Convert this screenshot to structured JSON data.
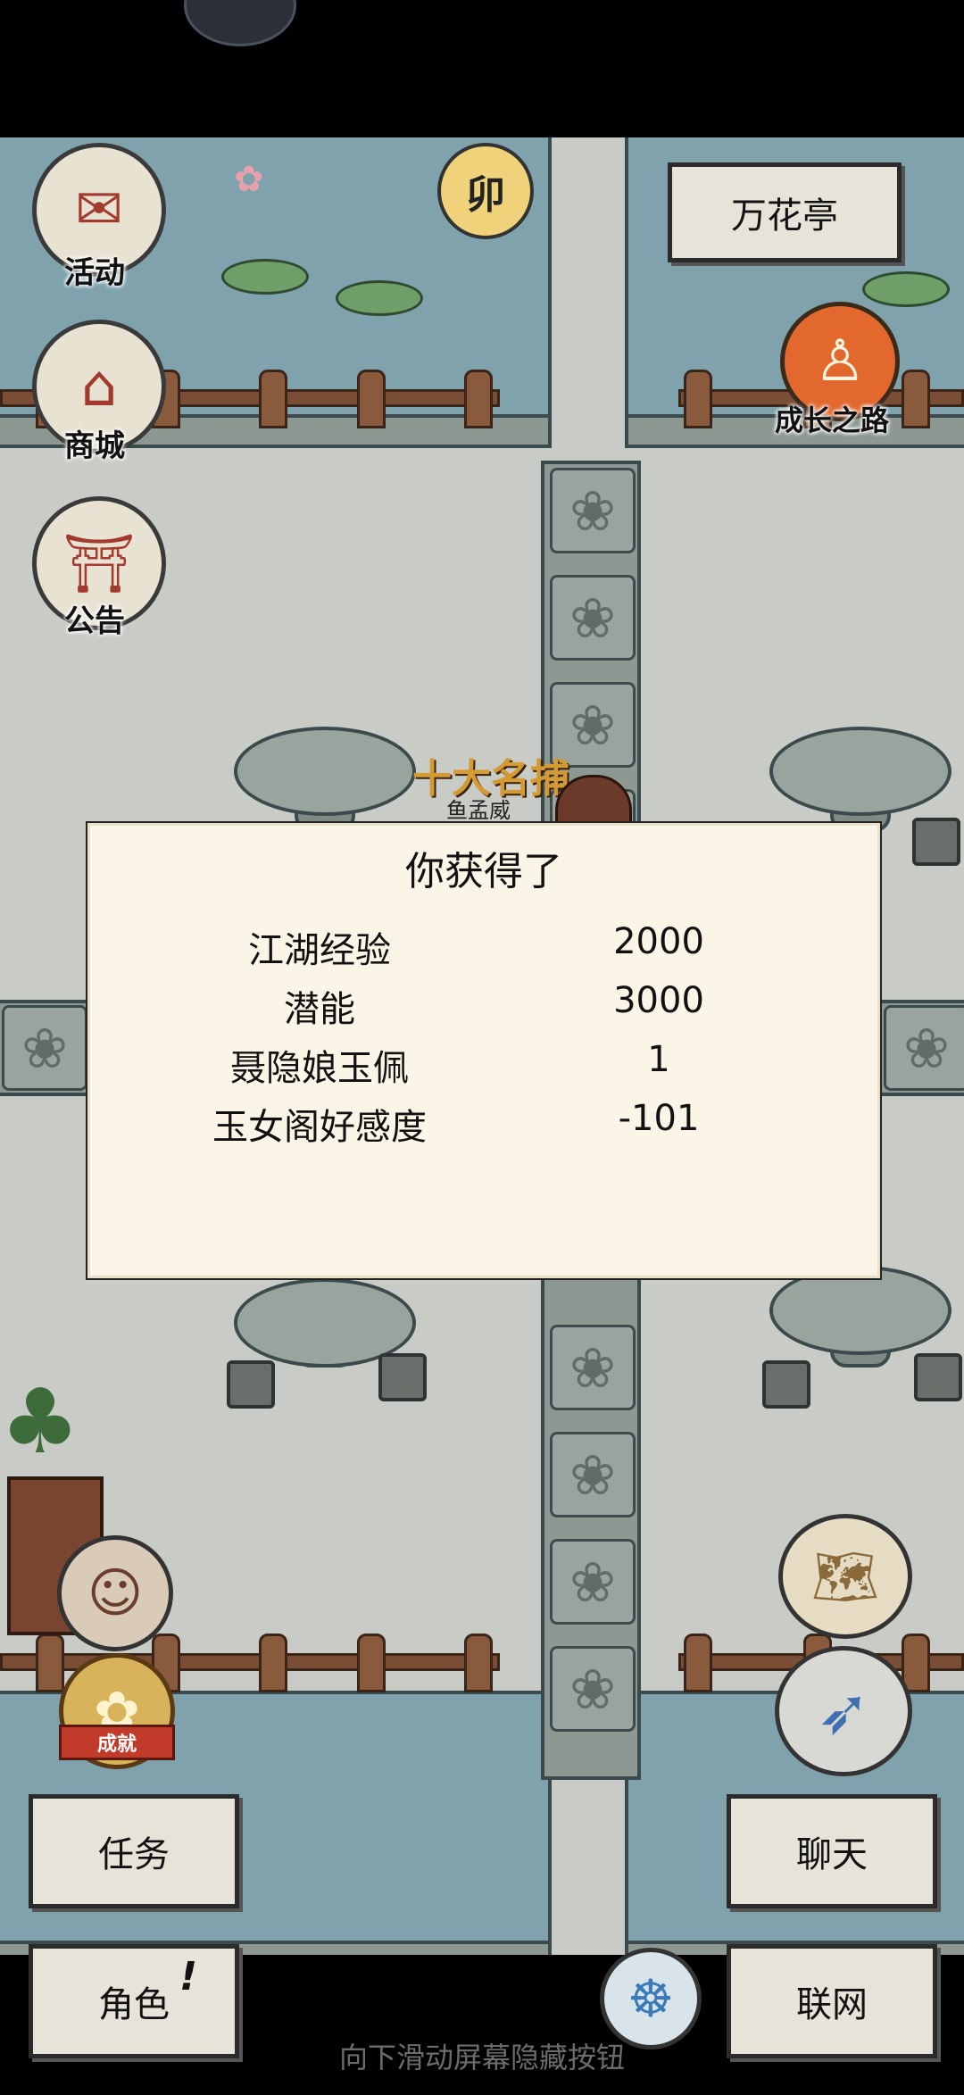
{
  "top_right_sign": {
    "label": "万花亭"
  },
  "left_menu": [
    {
      "label": "活动",
      "icon": "banner-scroll-icon"
    },
    {
      "label": "商城",
      "icon": "shop-stall-icon"
    },
    {
      "label": "公告",
      "icon": "notice-board-icon"
    }
  ],
  "time_badge": {
    "label": "卯"
  },
  "growth_path": {
    "label": "成长之路"
  },
  "npc": {
    "title": "十大名捕",
    "name": "鱼孟威"
  },
  "dialog": {
    "title": "你获得了",
    "rewards": [
      {
        "name": "江湖经验",
        "value": "2000"
      },
      {
        "name": "潜能",
        "value": "3000"
      },
      {
        "name": "聂隐娘玉佩",
        "value": "1"
      },
      {
        "name": "玉女阁好感度",
        "value": "-101"
      }
    ]
  },
  "achievement": {
    "label": "成就"
  },
  "bottom_buttons": {
    "quest": "任务",
    "chat": "聊天",
    "character": "角色",
    "character_alert": "!",
    "network": "联网"
  },
  "hint": "向下滑动屏幕隐藏按钮",
  "colors": {
    "water": "#7fa2ad",
    "ground": "#c9ccc6",
    "dialog_bg": "#faf5e6",
    "wood": "#7a4e35"
  }
}
